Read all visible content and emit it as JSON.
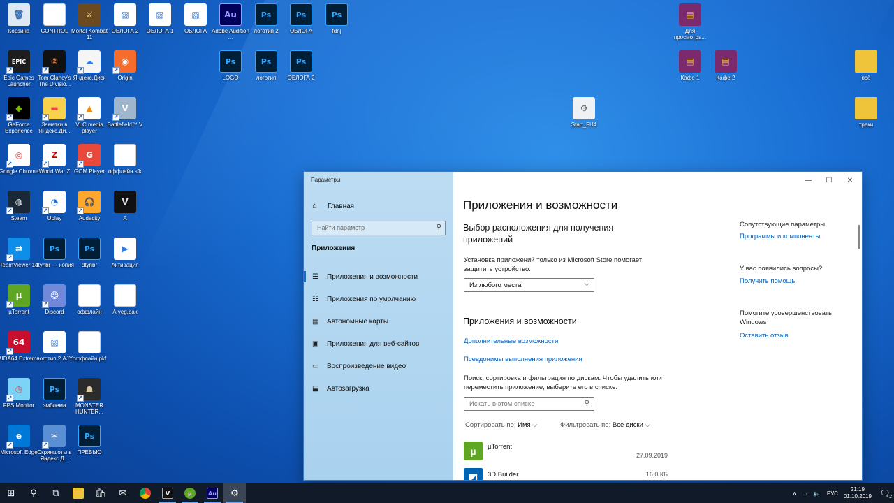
{
  "desktop": {
    "icons": [
      {
        "label": "Корзина",
        "kind": "bin"
      },
      {
        "label": "CONTROL",
        "kind": "file"
      },
      {
        "label": "Mortal Kombat 11",
        "kind": "game"
      },
      {
        "label": "ОБЛОГА 2",
        "kind": "img"
      },
      {
        "label": "ОБЛОГА 1",
        "kind": "img"
      },
      {
        "label": "ОБЛОГА",
        "kind": "img"
      },
      {
        "label": "Adobe Audition ...",
        "kind": "au"
      },
      {
        "label": "логотип 2",
        "kind": "ps"
      },
      {
        "label": "ОБЛОГА",
        "kind": "ps"
      },
      {
        "label": "fdnj",
        "kind": "ps"
      },
      {
        "label": "Для просмотра...",
        "kind": "rar"
      },
      {
        "label": "Epic Games Launcher",
        "kind": "epic"
      },
      {
        "label": "Tom Clancy's The Divisio...",
        "kind": "game2"
      },
      {
        "label": "Яндекс.Диск",
        "kind": "ydisk"
      },
      {
        "label": "Origin",
        "kind": "origin"
      },
      {
        "label": "LOGO",
        "kind": "ps"
      },
      {
        "label": "логотип",
        "kind": "ps"
      },
      {
        "label": "ОБЛОГА 2",
        "kind": "ps"
      },
      {
        "label": "Кафе 1",
        "kind": "rar"
      },
      {
        "label": "Кафе 2",
        "kind": "rar"
      },
      {
        "label": "всё",
        "kind": "folder"
      },
      {
        "label": "GeForce Experience",
        "kind": "nvidia"
      },
      {
        "label": "Заметки в Яндекс.Ди...",
        "kind": "notes"
      },
      {
        "label": "VLC media player",
        "kind": "vlc"
      },
      {
        "label": "Battlefield™ V",
        "kind": "bf"
      },
      {
        "label": "Start_FH4",
        "kind": "cfg"
      },
      {
        "label": "треки",
        "kind": "folder"
      },
      {
        "label": "Google Chrome",
        "kind": "chrome"
      },
      {
        "label": "World War Z",
        "kind": "wwz"
      },
      {
        "label": "GOM Player",
        "kind": "gom"
      },
      {
        "label": "оффлайн.sfk",
        "kind": "file"
      },
      {
        "label": "Steam",
        "kind": "steam"
      },
      {
        "label": "Uplay",
        "kind": "uplay"
      },
      {
        "label": "Audacity",
        "kind": "audacity"
      },
      {
        "label": "A",
        "kind": "vegas"
      },
      {
        "label": "TeamViewer 14",
        "kind": "tv"
      },
      {
        "label": "dtynbr — копия",
        "kind": "ps"
      },
      {
        "label": "dtynbr",
        "kind": "ps"
      },
      {
        "label": "Активация",
        "kind": "video"
      },
      {
        "label": "µTorrent",
        "kind": "utorrent"
      },
      {
        "label": "Discord",
        "kind": "discord"
      },
      {
        "label": "оффлайн",
        "kind": "file"
      },
      {
        "label": "A.veg.bak",
        "kind": "file"
      },
      {
        "label": "AIDA64 Extreme",
        "kind": "aida"
      },
      {
        "label": "логотип 2 AJY",
        "kind": "img"
      },
      {
        "label": "оффлайн.pkf",
        "kind": "file"
      },
      {
        "label": "FPS Monitor",
        "kind": "fps"
      },
      {
        "label": "эмблема",
        "kind": "ps"
      },
      {
        "label": "MONSTER HUNTER...",
        "kind": "mh"
      },
      {
        "label": "Microsoft Edge",
        "kind": "edge"
      },
      {
        "label": "Скриншоты в Яндекс.Д...",
        "kind": "scissors"
      },
      {
        "label": "ПРЕВЬЮ",
        "kind": "ps"
      }
    ]
  },
  "settings": {
    "window_title": "Параметры",
    "sidebar": {
      "home": "Главная",
      "search_placeholder": "Найти параметр",
      "section": "Приложения",
      "items": [
        {
          "label": "Приложения и возможности",
          "icon": "list-icon"
        },
        {
          "label": "Приложения по умолчанию",
          "icon": "default-apps-icon"
        },
        {
          "label": "Автономные карты",
          "icon": "map-icon"
        },
        {
          "label": "Приложения для веб-сайтов",
          "icon": "web-apps-icon"
        },
        {
          "label": "Воспроизведение видео",
          "icon": "video-icon"
        },
        {
          "label": "Автозагрузка",
          "icon": "startup-icon"
        }
      ]
    },
    "main": {
      "title": "Приложения и возможности",
      "install_heading": "Выбор расположения для получения приложений",
      "install_desc": "Установка приложений только из Microsoft Store помогает защитить устройство.",
      "install_select": "Из любого места",
      "apps_heading": "Приложения и возможности",
      "link_optional": "Дополнительные возможности",
      "link_aliases": "Псевдонимы выполнения приложения",
      "search_desc": "Поиск, сортировка и фильтрация по дискам. Чтобы удалить или переместить приложение, выберите его в списке.",
      "search_placeholder": "Искать в этом списке",
      "sort_label": "Сортировать по:",
      "sort_value": "Имя",
      "filter_label": "Фильтровать по:",
      "filter_value": "Все диски",
      "apps": [
        {
          "name": "µTorrent",
          "meta": "27.09.2019",
          "color": "#5ea623"
        },
        {
          "name": "3D Builder",
          "meta": "16,0 КБ",
          "color": "#0063b1"
        }
      ]
    },
    "right": {
      "related_heading": "Сопутствующие параметры",
      "related_link": "Программы и компоненты",
      "question_heading": "У вас появились вопросы?",
      "question_link": "Получить помощь",
      "improve_heading": "Помогите усовершенствовать Windows",
      "improve_link": "Оставить отзыв"
    }
  },
  "taskbar": {
    "lang": "РУС",
    "time": "21:19",
    "date": "01.10.2019",
    "notification_count": "2"
  },
  "colors": {
    "accent": "#0a5fb4",
    "taskbar": "#101a28",
    "sidebar": "#b3d7f0"
  }
}
